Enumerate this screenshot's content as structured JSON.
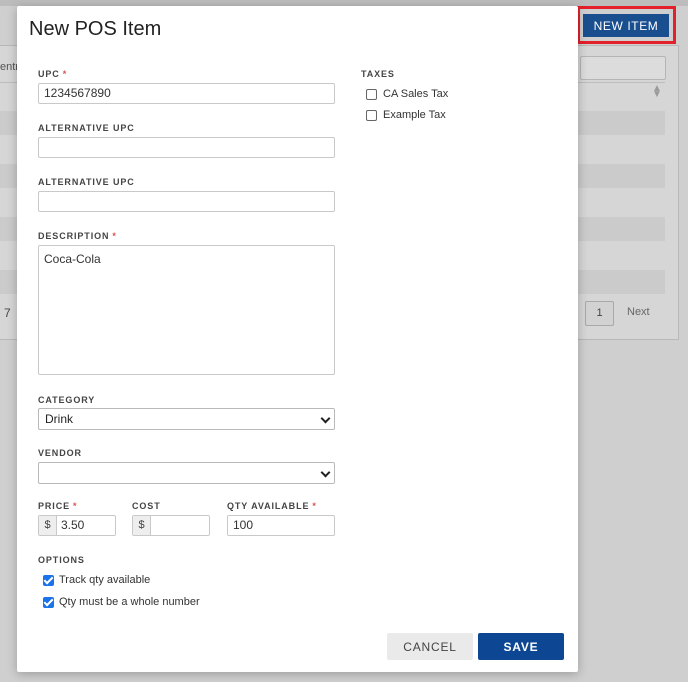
{
  "background": {
    "entries_fragment": "entri",
    "page_number": "1",
    "next_label": "Next",
    "left_fragment": "7",
    "new_item_label": "NEW ITEM"
  },
  "modal": {
    "title": "New POS Item",
    "upc": {
      "label": "UPC",
      "value": "1234567890"
    },
    "alt_upc_1": {
      "label": "ALTERNATIVE UPC",
      "value": ""
    },
    "alt_upc_2": {
      "label": "ALTERNATIVE UPC",
      "value": ""
    },
    "description": {
      "label": "DESCRIPTION",
      "value": "Coca-Cola"
    },
    "category": {
      "label": "CATEGORY",
      "value": "Drink"
    },
    "vendor": {
      "label": "VENDOR",
      "value": ""
    },
    "price": {
      "label": "PRICE",
      "prefix": "$",
      "value": "3.50"
    },
    "cost": {
      "label": "COST",
      "prefix": "$",
      "value": ""
    },
    "qty": {
      "label": "QTY AVAILABLE",
      "value": "100"
    },
    "required_mark": "*",
    "options": {
      "label": "OPTIONS",
      "items": [
        {
          "label": "Track qty available",
          "checked": true
        },
        {
          "label": "Qty must be a whole number",
          "checked": true
        }
      ]
    },
    "taxes": {
      "label": "TAXES",
      "items": [
        {
          "label": "CA Sales Tax",
          "checked": false
        },
        {
          "label": "Example Tax",
          "checked": false
        }
      ]
    },
    "cancel_label": "CANCEL",
    "save_label": "SAVE"
  }
}
